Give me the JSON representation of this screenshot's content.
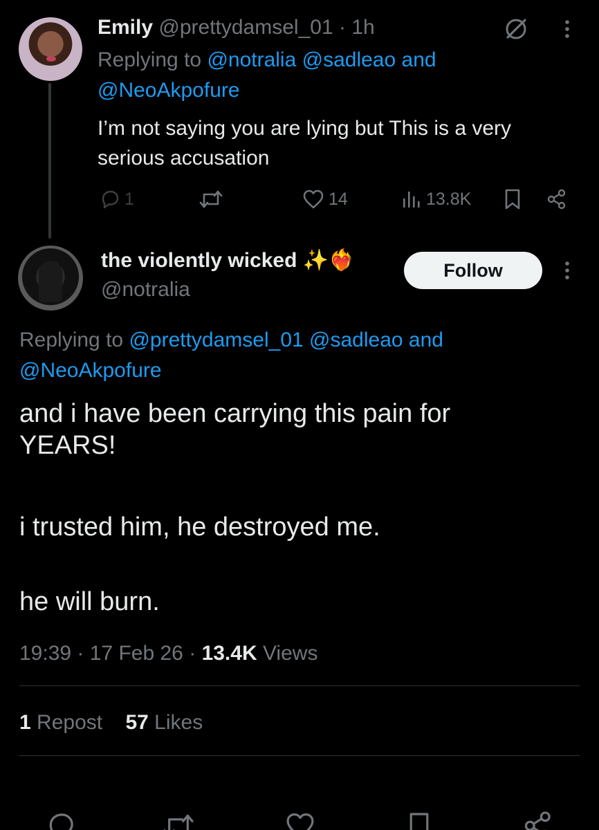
{
  "reply": {
    "name": "Emily",
    "handle": "@prettydamsel_01",
    "dot": "·",
    "time": "1h",
    "replying_prefix": "Replying to",
    "replying_users_line1": "@notralia @sadleao",
    "replying_and": "and",
    "replying_users_line2": "@NeoAkpofure",
    "text_line1": "I’m not saying you are lying but This is a very",
    "text_line2": "serious accusation",
    "reply_count": "1",
    "like_count": "14",
    "view_count": "13.8K"
  },
  "main": {
    "name": "the violently wicked",
    "emoji": "✨❤️‍🔥",
    "handle": "@notralia",
    "follow_label": "Follow",
    "replying_prefix": "Replying to",
    "replying_users_line1": "@prettydamsel_01 @sadleao",
    "replying_and": "and",
    "replying_users_line2": "@NeoAkpofure",
    "text_p1_line1": "and i have been carrying this pain for",
    "text_p1_line2": "YEARS!",
    "text_p2": "i trusted him, he destroyed me.",
    "text_p3": "he will burn.",
    "time": "19:39",
    "dot": "·",
    "date": "17 Feb 26",
    "views_count": "13.4K",
    "views_label": "Views",
    "reposts_count": "1",
    "reposts_label": "Repost",
    "likes_count": "57",
    "likes_label": "Likes"
  },
  "colors": {
    "background": "#000000",
    "text": "#e7e9ea",
    "muted": "#71767b",
    "link": "#1d9bf0",
    "divider": "#2f3336"
  },
  "icons": [
    "grok-icon",
    "more-icon",
    "reply-icon",
    "repost-icon",
    "like-icon",
    "views-icon",
    "bookmark-icon",
    "share-icon"
  ]
}
